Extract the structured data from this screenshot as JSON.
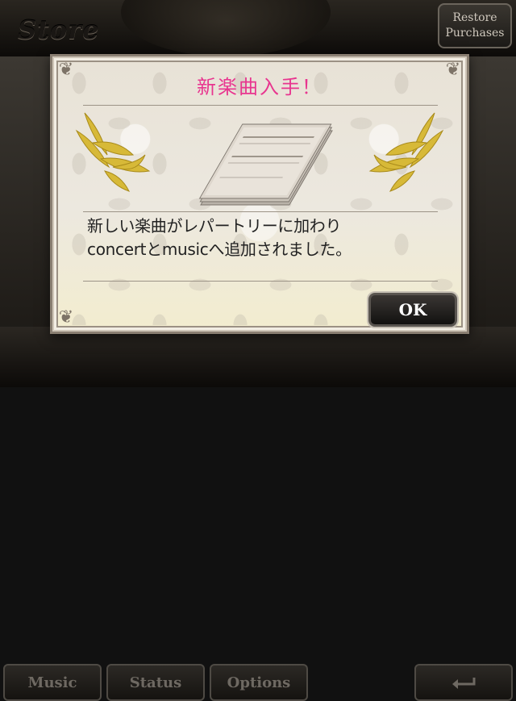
{
  "header": {
    "title": "Store",
    "restore_label_line1": "Restore",
    "restore_label_line2": "Purchases"
  },
  "nav": {
    "music_label": "Music",
    "status_label": "Status",
    "options_label": "Options",
    "back_icon": "return-arrow-icon"
  },
  "dialog": {
    "title": "新楽曲入手！",
    "message_line1": "新しい楽曲がレパートリーに加わり",
    "message_line2": "concertとmusicへ追加されました。",
    "ok_label": "OK",
    "image_icon": "sheet-music-icon",
    "decoration_icon": "gold-laurel-icon"
  },
  "colors": {
    "title_pink": "#e8358f",
    "laurel_gold": "#d7b938"
  }
}
